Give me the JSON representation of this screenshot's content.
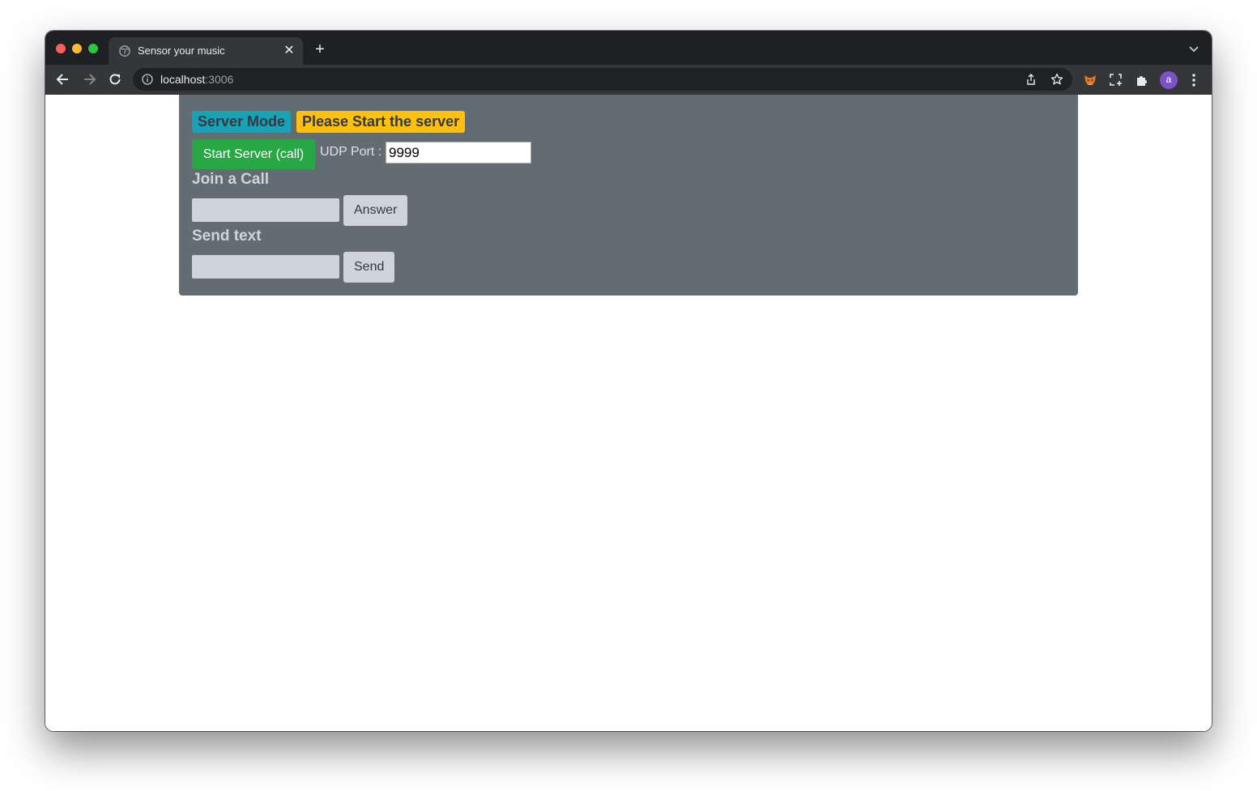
{
  "browser": {
    "tab_title": "Sensor your music",
    "tab_close_glyph": "✕",
    "new_tab_glyph": "+",
    "url_host": "localhost",
    "url_port": ":3006",
    "profile_initial": "a"
  },
  "icons": {
    "tab_favicon": "globe-icon",
    "back": "arrow-left-icon",
    "forward": "arrow-right-icon",
    "reload": "reload-icon",
    "site_info": "info-icon",
    "share": "share-icon",
    "bookmark": "star-icon",
    "extension_fox": "fox-extension-icon",
    "extension_capture": "capture-icon",
    "extensions": "puzzle-icon",
    "menu": "kebab-menu-icon",
    "tab_list": "chevron-down-icon"
  },
  "colors": {
    "panel_bg": "#636c72",
    "badge_mode": "#17a2b8",
    "badge_status": "#ffc107",
    "start_button": "#28a745",
    "gray_control": "#ced4da"
  },
  "app": {
    "mode_badge": "Server Mode",
    "status_badge": "Please Start the server",
    "start_server_label": "Start Server (call)",
    "udp_port_label": "UDP Port :",
    "udp_port_value": "9999",
    "join_call_heading": "Join a Call",
    "join_call_input_value": "",
    "answer_label": "Answer",
    "send_text_heading": "Send text",
    "send_text_input_value": "",
    "send_label": "Send"
  }
}
